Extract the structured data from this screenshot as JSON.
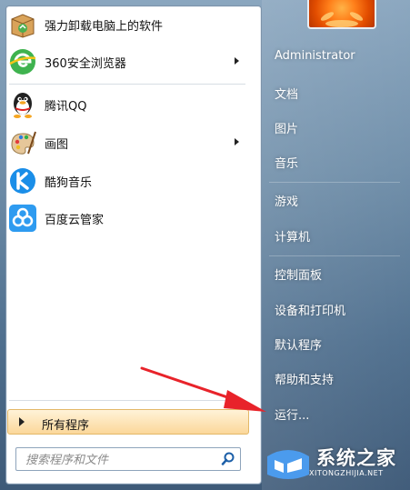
{
  "left_menu": {
    "programs": [
      {
        "label": "强力卸载电脑上的软件",
        "icon": "uninstaller-box-icon"
      },
      {
        "label": "360安全浏览器",
        "icon": "360-browser-icon",
        "has_arrow": true
      },
      {
        "label": "腾讯QQ",
        "icon": "qq-penguin-icon"
      },
      {
        "label": "画图",
        "icon": "paint-palette-icon",
        "has_arrow": true
      },
      {
        "label": "酷狗音乐",
        "icon": "kugou-music-icon"
      },
      {
        "label": "百度云管家",
        "icon": "baidu-cloud-icon"
      }
    ],
    "all_programs_label": "所有程序",
    "search_placeholder": "搜索程序和文件"
  },
  "right_menu": {
    "user": "Administrator",
    "items": [
      "文档",
      "图片",
      "音乐",
      "游戏",
      "计算机",
      "控制面板",
      "设备和打印机",
      "默认程序",
      "帮助和支持",
      "运行..."
    ]
  },
  "watermark": {
    "text": "系统之家",
    "url": "XITONGZHIJIA.NET"
  },
  "colors": {
    "annotation_arrow": "#e8232a",
    "all_programs_bg": "#fbd79a"
  }
}
